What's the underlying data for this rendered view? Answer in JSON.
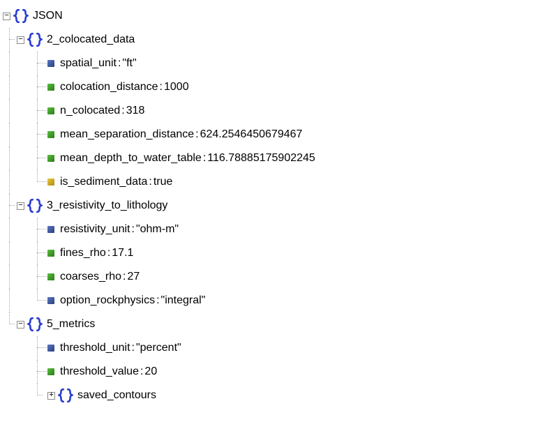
{
  "root": {
    "label": "JSON"
  },
  "node_2": {
    "label": "2_colocated_data",
    "spatial_unit": {
      "key": "spatial_unit",
      "value": "\"ft\""
    },
    "colocation_distance": {
      "key": "colocation_distance",
      "value": "1000"
    },
    "n_colocated": {
      "key": "n_colocated",
      "value": "318"
    },
    "mean_separation_distance": {
      "key": "mean_separation_distance",
      "value": "624.2546450679467"
    },
    "mean_depth_to_water_table": {
      "key": "mean_depth_to_water_table",
      "value": "116.78885175902245"
    },
    "is_sediment_data": {
      "key": "is_sediment_data",
      "value": "true"
    }
  },
  "node_3": {
    "label": "3_resistivity_to_lithology",
    "resistivity_unit": {
      "key": "resistivity_unit",
      "value": "\"ohm-m\""
    },
    "fines_rho": {
      "key": "fines_rho",
      "value": "17.1"
    },
    "coarses_rho": {
      "key": "coarses_rho",
      "value": "27"
    },
    "option_rockphysics": {
      "key": "option_rockphysics",
      "value": "\"integral\""
    }
  },
  "node_5": {
    "label": "5_metrics",
    "threshold_unit": {
      "key": "threshold_unit",
      "value": "\"percent\""
    },
    "threshold_value": {
      "key": "threshold_value",
      "value": "20"
    },
    "saved_contours": {
      "label": "saved_contours"
    }
  },
  "glyphs": {
    "minus": "−",
    "plus": "+",
    "colon": " : "
  }
}
